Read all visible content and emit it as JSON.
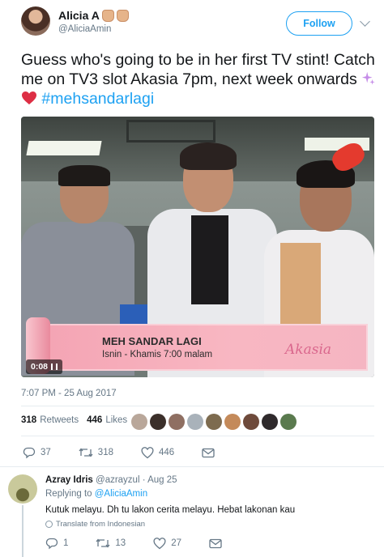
{
  "tweet": {
    "author_name": "Alicia A",
    "author_handle": "@AliciaAmin",
    "follow_label": "Follow",
    "text_main": "Guess who's going to be in her first TV stint! Catch me on TV3 slot Akasia 7pm, next week onwards ",
    "hashtag": "#mehsandarlagi",
    "timestamp": "7:07 PM - 25 Aug 2017",
    "retweets_count": "318",
    "retweets_label": "Retweets",
    "likes_count": "446",
    "likes_label": "Likes",
    "replies": "37",
    "retweets": "318",
    "likes": "446"
  },
  "video": {
    "banner_title": "MEH SANDAR LAGI",
    "banner_schedule": "Isnin - Khamis  7:00 malam",
    "banner_logo": "Akasia",
    "duration": "0:08"
  },
  "reply": {
    "name": "Azray Idris",
    "handle_date": "@azrayzul · Aug 25",
    "replying_prefix": "Replying to ",
    "replying_to": "@AliciaAmin",
    "text": "Kutuk melayu. Dh tu lakon cerita melayu. Hebat lakonan kau",
    "translate": "Translate from Indonesian",
    "replies": "1",
    "retweets": "13",
    "likes": "27"
  },
  "colors": {
    "accent": "#1da1f2",
    "muted": "#657786",
    "text": "#14171a",
    "heart": "#e0245e"
  }
}
